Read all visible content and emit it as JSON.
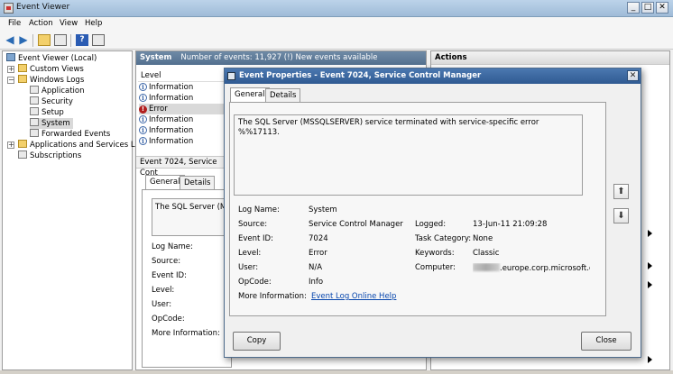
{
  "window": {
    "title": "Event Viewer",
    "controls": {
      "minimize": "_",
      "maximize": "□",
      "close": "✕"
    }
  },
  "menu": [
    "File",
    "Action",
    "View",
    "Help"
  ],
  "toolbar_icons": [
    "back-arrow-icon",
    "forward-arrow-icon",
    "folder-up-icon",
    "console-tree-icon",
    "help-icon",
    "properties-icon"
  ],
  "tree": {
    "root": "Event Viewer (Local)",
    "items": [
      {
        "label": "Custom Views"
      },
      {
        "label": "Windows Logs"
      },
      {
        "label": "Application"
      },
      {
        "label": "Security"
      },
      {
        "label": "Setup"
      },
      {
        "label": "System"
      },
      {
        "label": "Forwarded Events"
      },
      {
        "label": "Applications and Services Logs"
      },
      {
        "label": "Subscriptions"
      }
    ]
  },
  "center": {
    "log_name": "System",
    "count_text": "Number of events: 11,927 (!) New events available",
    "column_level": "Level",
    "events": [
      {
        "level": "Information"
      },
      {
        "level": "Information"
      },
      {
        "level": "Error"
      },
      {
        "level": "Information"
      },
      {
        "level": "Information"
      },
      {
        "level": "Information"
      }
    ],
    "detail_header": "Event 7024, Service Cont",
    "tabs": [
      "General",
      "Details"
    ],
    "desc_preview": "The SQL Server (MS",
    "labels": [
      "Log Name:",
      "Source:",
      "Event ID:",
      "Level:",
      "User:",
      "OpCode:",
      "More Information:"
    ]
  },
  "actions": {
    "title": "Actions"
  },
  "dialog": {
    "title": "Event Properties - Event 7024, Service Control Manager",
    "close": "✕",
    "tabs": [
      "General",
      "Details"
    ],
    "description": "The SQL Server (MSSQLSERVER) service terminated with service-specific error %%17113.",
    "fields_left": [
      {
        "label": "Log Name:",
        "value": "System"
      },
      {
        "label": "Source:",
        "value": "Service Control Manager"
      },
      {
        "label": "Event ID:",
        "value": "7024"
      },
      {
        "label": "Level:",
        "value": "Error"
      },
      {
        "label": "User:",
        "value": "N/A"
      },
      {
        "label": "OpCode:",
        "value": "Info"
      },
      {
        "label": "More Information:",
        "value": "Event Log Online Help"
      }
    ],
    "fields_right": [
      {
        "label": "Logged:",
        "value": "13-Jun-11 21:09:28"
      },
      {
        "label": "Task Category:",
        "value": "None"
      },
      {
        "label": "Keywords:",
        "value": "Classic"
      },
      {
        "label": "Computer:",
        "value": ".europe.corp.microsoft.co"
      }
    ],
    "buttons": {
      "copy": "Copy",
      "close": "Close"
    },
    "arrows": {
      "up": "⬆",
      "down": "⬇"
    }
  }
}
